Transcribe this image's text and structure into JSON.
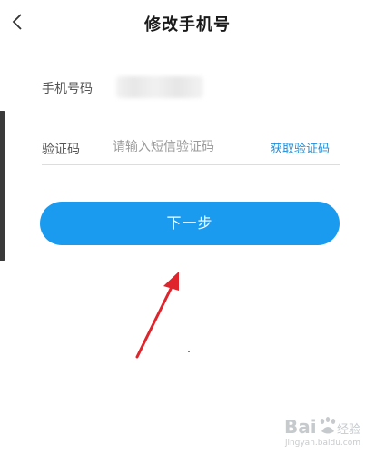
{
  "header": {
    "back_icon": "chevron-left-icon",
    "title": "修改手机号"
  },
  "form": {
    "phone_label": "手机号码",
    "code_label": "验证码",
    "code_placeholder": "请输入短信验证码",
    "get_code_label": "获取验证码",
    "next_label": "下一步"
  },
  "annotation": {
    "arrow_color": "#e0242b"
  },
  "watermark": {
    "brand": "Bai经验",
    "url": "jingyan.baidu.com"
  },
  "colors": {
    "accent": "#1b9bf0",
    "link": "#1e8fda"
  }
}
